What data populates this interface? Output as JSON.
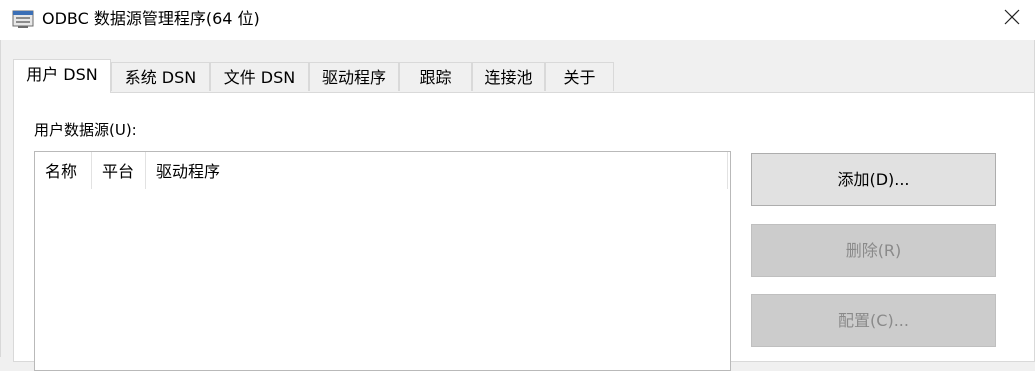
{
  "window": {
    "title": "ODBC 数据源管理程序(64 位)",
    "icons": {
      "app": "odbc-app-icon",
      "close": "close-icon"
    }
  },
  "tabs": [
    {
      "label": "用户 DSN",
      "active": true
    },
    {
      "label": "系统 DSN",
      "active": false
    },
    {
      "label": "文件 DSN",
      "active": false
    },
    {
      "label": "驱动程序",
      "active": false
    },
    {
      "label": "跟踪",
      "active": false
    },
    {
      "label": "连接池",
      "active": false
    },
    {
      "label": "关于",
      "active": false
    }
  ],
  "user_dsn": {
    "group_label": "用户数据源(U):",
    "columns": [
      "名称",
      "平台",
      "驱动程序"
    ],
    "rows": []
  },
  "buttons": {
    "add": {
      "label": "添加(D)...",
      "enabled": true
    },
    "remove": {
      "label": "删除(R)",
      "enabled": false
    },
    "configure": {
      "label": "配置(C)...",
      "enabled": false
    }
  },
  "colors": {
    "window_bg": "#f0f0f0",
    "panel_bg": "#ffffff",
    "button_bg": "#e1e1e1",
    "disabled_text": "#8a8a8a"
  }
}
